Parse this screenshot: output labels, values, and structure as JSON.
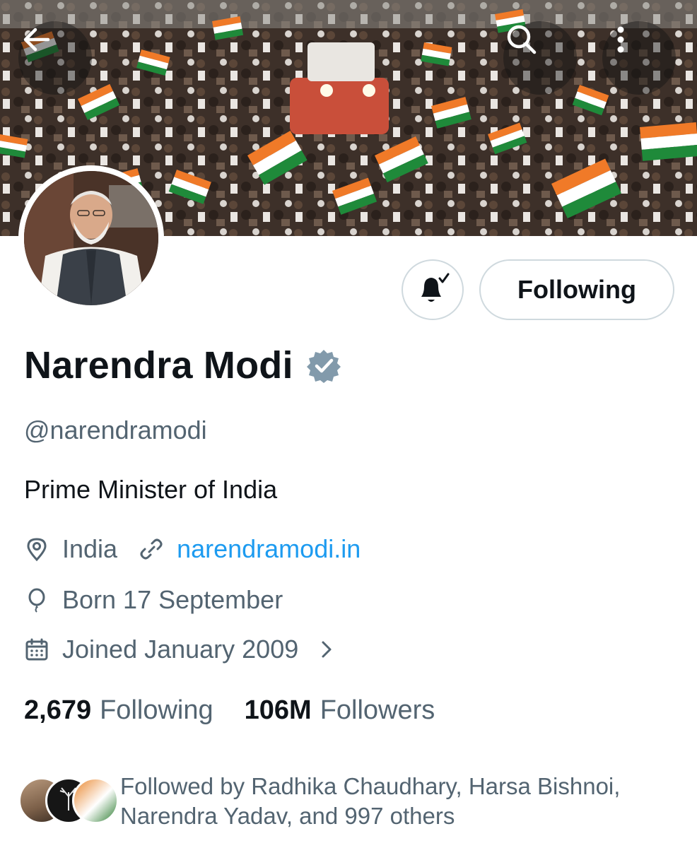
{
  "header": {
    "back_icon": "arrow-left-icon",
    "search_icon": "search-icon",
    "more_icon": "more-vertical-icon"
  },
  "banner": {
    "description_icon": "banner-photo"
  },
  "actions": {
    "notify_icon": "bell-check-icon",
    "following_label": "Following"
  },
  "profile": {
    "name": "Narendra Modi",
    "verified_icon": "verified-badge-icon",
    "handle": "@narendramodi",
    "bio": "Prime Minister of India",
    "location": "India",
    "website": "narendramodi.in",
    "born": "Born 17 September",
    "joined": "Joined January 2009"
  },
  "stats": {
    "following_count": "2,679",
    "following_label": "Following",
    "followers_count": "106M",
    "followers_label": "Followers"
  },
  "followed_by": {
    "line1": "Followed by Radhika Chaudhary, Harsa Bishnoi,",
    "line2": "Narendra Yadav, and 997 others"
  },
  "colors": {
    "accent": "#1d9bf0",
    "text_primary": "#0f1419",
    "text_secondary": "#536471",
    "border": "#cfd9de",
    "verified": "#829aab"
  }
}
